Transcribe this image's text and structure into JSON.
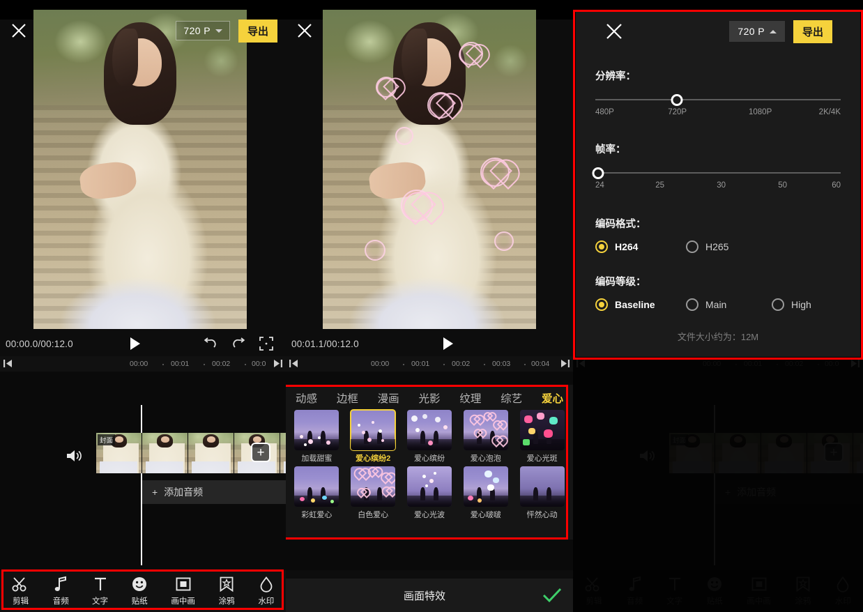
{
  "app": {
    "close_label": "×",
    "export_label": "导出",
    "resolution_value": "720 P"
  },
  "left_panel": {
    "time_display": "00:00.0/00:12.0",
    "ruler_ticks": [
      "00:00",
      "00:01",
      "00:02",
      "00:0"
    ],
    "cover_badge": "封面",
    "add_audio_label": "添加音频",
    "add_plus": "+",
    "controls": {
      "play": "play-icon",
      "undo": "undo-icon",
      "redo": "redo-icon",
      "fullscreen": "fullscreen-icon"
    }
  },
  "mid_panel": {
    "time_display": "00:01.1/00:12.0",
    "ruler_ticks": [
      "00:00",
      "00:01",
      "00:02",
      "00:03",
      "00:04"
    ],
    "footer_title": "画面特效",
    "confirm": "check-icon"
  },
  "effects": {
    "tabs": [
      {
        "label": "动感",
        "active": false
      },
      {
        "label": "边框",
        "active": false
      },
      {
        "label": "漫画",
        "active": false
      },
      {
        "label": "光影",
        "active": false
      },
      {
        "label": "纹理",
        "active": false
      },
      {
        "label": "综艺",
        "active": false
      },
      {
        "label": "爱心",
        "active": true
      }
    ],
    "items": [
      {
        "label": "加载甜蜜",
        "selected": false
      },
      {
        "label": "爱心缤纷2",
        "selected": true
      },
      {
        "label": "爱心缤纷",
        "selected": false
      },
      {
        "label": "爱心泡泡",
        "selected": false
      },
      {
        "label": "爱心光斑",
        "selected": false
      },
      {
        "label": "彩虹爱心",
        "selected": false
      },
      {
        "label": "白色爱心",
        "selected": false
      },
      {
        "label": "爱心光波",
        "selected": false
      },
      {
        "label": "爱心啵啵",
        "selected": false
      },
      {
        "label": "怦然心动",
        "selected": false
      }
    ]
  },
  "export_sheet": {
    "resolution": {
      "label": "分辨率：",
      "ticks": [
        "480P",
        "720P",
        "1080P",
        "2K/4K"
      ],
      "selected": "720P",
      "knob_percent": 33.3
    },
    "framerate": {
      "label": "帧率：",
      "ticks": [
        "24",
        "25",
        "30",
        "50",
        "60"
      ],
      "selected": "24",
      "knob_percent": 0
    },
    "codec": {
      "label": "编码格式：",
      "options": [
        {
          "label": "H264",
          "selected": true
        },
        {
          "label": "H265",
          "selected": false
        }
      ]
    },
    "profile": {
      "label": "编码等级：",
      "options": [
        {
          "label": "Baseline",
          "selected": true
        },
        {
          "label": "Main",
          "selected": false
        },
        {
          "label": "High",
          "selected": false
        }
      ]
    },
    "file_size": "文件大小约为：12M"
  },
  "toolbar": {
    "items": [
      {
        "label": "剪辑",
        "icon": "scissors-icon"
      },
      {
        "label": "音频",
        "icon": "music-note-icon"
      },
      {
        "label": "文字",
        "icon": "text-t-icon"
      },
      {
        "label": "贴纸",
        "icon": "smiley-icon"
      },
      {
        "label": "画中画",
        "icon": "picture-in-picture-icon"
      },
      {
        "label": "涂鸦",
        "icon": "doodle-star-icon"
      },
      {
        "label": "水印",
        "icon": "watermark-drop-icon"
      }
    ]
  },
  "colors": {
    "accent_yellow": "#f5d23c",
    "annotation_red": "#ff0000",
    "confirm_green": "#3ecf6a",
    "panel_bg": "#1b1b1b"
  }
}
